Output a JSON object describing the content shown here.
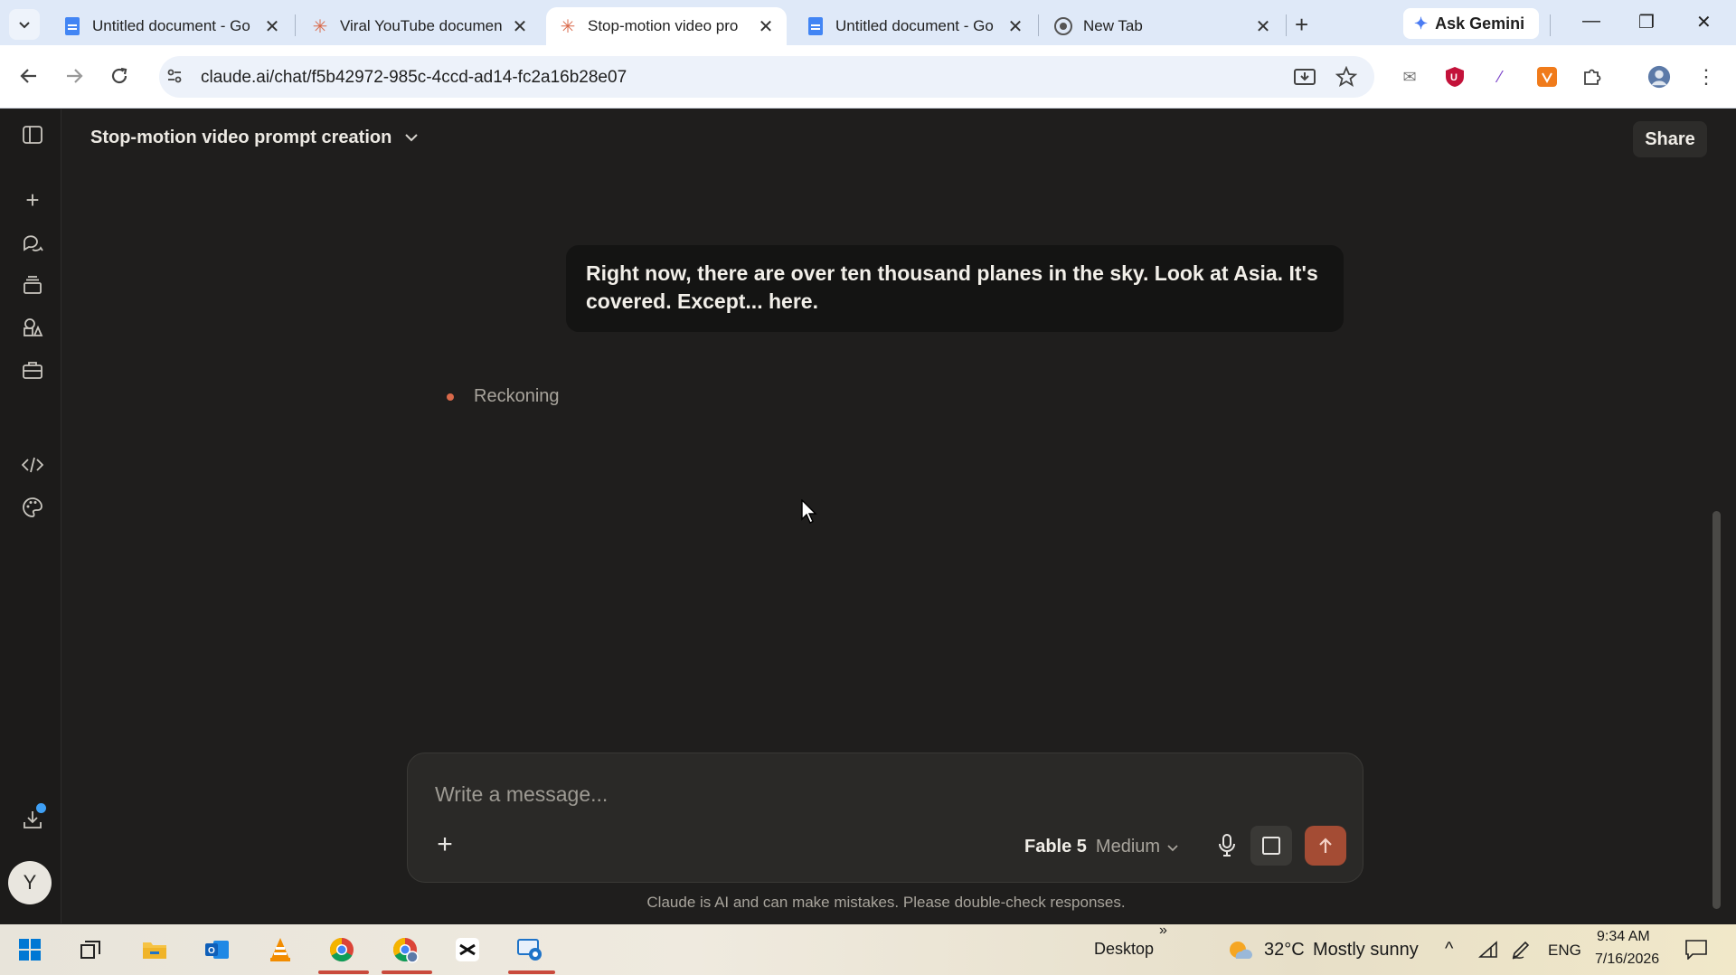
{
  "browser": {
    "tabs": [
      {
        "title": "Untitled document - Go",
        "favicon": "google-docs-icon",
        "active": false
      },
      {
        "title": "Viral YouTube documen",
        "favicon": "claude-icon",
        "active": false
      },
      {
        "title": "Stop-motion video pro",
        "favicon": "claude-icon",
        "active": true
      },
      {
        "title": "Untitled document - Go",
        "favicon": "google-docs-icon",
        "active": false
      },
      {
        "title": "New Tab",
        "favicon": "chrome-icon",
        "active": false
      }
    ],
    "gemini_label": "Ask Gemini",
    "url": "claude.ai/chat/f5b42972-985c-4ccd-ad14-fc2a16b28e07"
  },
  "chat": {
    "title": "Stop-motion video prompt creation",
    "share_label": "Share",
    "user_message": "Right now, there are over ten thousand planes in the sky. Look at Asia. It's covered. Except... here.",
    "status": "Reckoning",
    "composer_placeholder": "Write a message...",
    "model_name": "Fable 5",
    "effort": "Medium",
    "disclaimer": "Claude is AI and can make mistakes. Please double-check responses.",
    "avatar_initial": "Y"
  },
  "taskbar": {
    "desktop_label": "Desktop",
    "chevron": "»",
    "temperature": "32°C",
    "weather": "Mostly sunny",
    "language": "ENG",
    "time": "9:34 AM",
    "date": "7/16/2026"
  },
  "colors": {
    "accent": "#d9694a",
    "send_button": "#a44c34",
    "background": "#1f1e1d"
  }
}
